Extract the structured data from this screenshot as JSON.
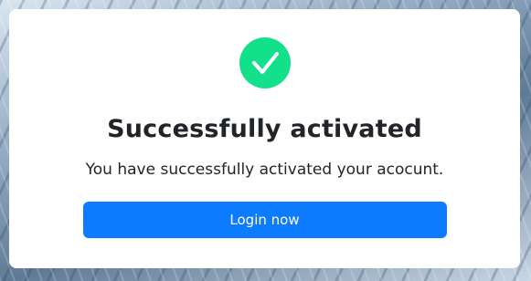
{
  "dialog": {
    "icon": "checkmark-circle-icon",
    "icon_color": "#12e08b",
    "title": "Successfully activated",
    "message": "You have successfully activated your acocunt.",
    "button_label": "Login now",
    "button_color": "#0d7bfd"
  }
}
